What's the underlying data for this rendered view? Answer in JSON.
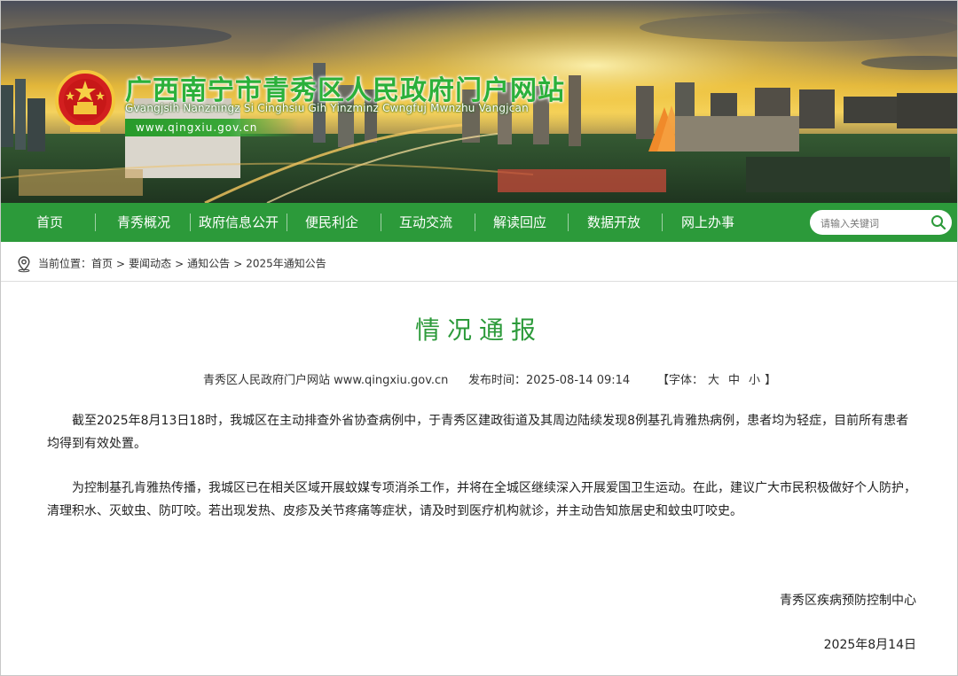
{
  "header": {
    "site_title": "广西南宁市青秀区人民政府门户网站",
    "site_title_zhuang": "Gvangjsih Nanzningz Si Cinghsiu Gih Yinzminz Cwngfuj Mwnzhu Vangjcan",
    "site_url": "www.qingxiu.gov.cn"
  },
  "nav": {
    "items": [
      {
        "label": "首页"
      },
      {
        "label": "青秀概况"
      },
      {
        "label": "政府信息公开"
      },
      {
        "label": "便民利企"
      },
      {
        "label": "互动交流"
      },
      {
        "label": "解读回应"
      },
      {
        "label": "数据开放"
      },
      {
        "label": "网上办事"
      }
    ],
    "search_placeholder": "请输入关键词"
  },
  "breadcrumb": {
    "prefix": "当前位置：",
    "items": [
      "首页",
      "要闻动态",
      "通知公告",
      "2025年通知公告"
    ],
    "separator": ">"
  },
  "article": {
    "title": "情况通报",
    "source": "青秀区人民政府门户网站 www.qingxiu.gov.cn",
    "publish_label": "发布时间：",
    "publish_time": "2025-08-14 09:14",
    "font_label": "【字体：",
    "font_sizes": [
      "大",
      "中",
      "小"
    ],
    "font_close": "】",
    "paragraphs": [
      "截至2025年8月13日18时，我城区在主动排查外省协查病例中，于青秀区建政街道及其周边陆续发现8例基孔肯雅热病例，患者均为轻症，目前所有患者均得到有效处置。",
      "为控制基孔肯雅热传播，我城区已在相关区域开展蚊媒专项消杀工作，并将在全城区继续深入开展爱国卫生运动。在此，建议广大市民积极做好个人防护，清理积水、灭蚊虫、防叮咬。若出现发热、皮疹及关节疼痛等症状，请及时到医疗机构就诊，并主动告知旅居史和蚊虫叮咬史。"
    ],
    "signature": "青秀区疾病预防控制中心",
    "sign_date": "2025年8月14日"
  },
  "colors": {
    "brand_green": "#2c9a3a",
    "title_green": "#2bb03a"
  },
  "icons": [
    "national-emblem-icon",
    "search-icon",
    "location-pin-icon"
  ]
}
